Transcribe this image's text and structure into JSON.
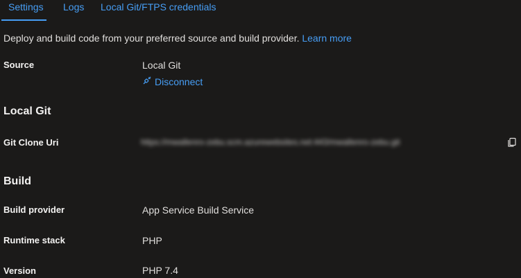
{
  "tabs": [
    {
      "label": "Settings",
      "active": true
    },
    {
      "label": "Logs",
      "active": false
    },
    {
      "label": "Local Git/FTPS credentials",
      "active": false
    }
  ],
  "intro": {
    "text": "Deploy and build code from your preferred source and build provider.",
    "link": "Learn more"
  },
  "source": {
    "label": "Source",
    "value": "Local Git",
    "disconnect": "Disconnect"
  },
  "local_git": {
    "heading": "Local Git",
    "clone_uri_label": "Git Clone Uri",
    "clone_uri_value": "https://mwallenro-zebu.scm.azurewebsites.net:443/mwallenro-zebu.git"
  },
  "build": {
    "heading": "Build",
    "rows": [
      {
        "label": "Build provider",
        "value": "App Service Build Service"
      },
      {
        "label": "Runtime stack",
        "value": "PHP"
      },
      {
        "label": "Version",
        "value": "PHP 7.4"
      }
    ]
  },
  "icons": {
    "disconnect": "plug-disconnect-icon",
    "copy": "copy-icon"
  },
  "colors": {
    "accent": "#479ef5",
    "background": "#1b1a19",
    "text": "#e1dfdd"
  }
}
